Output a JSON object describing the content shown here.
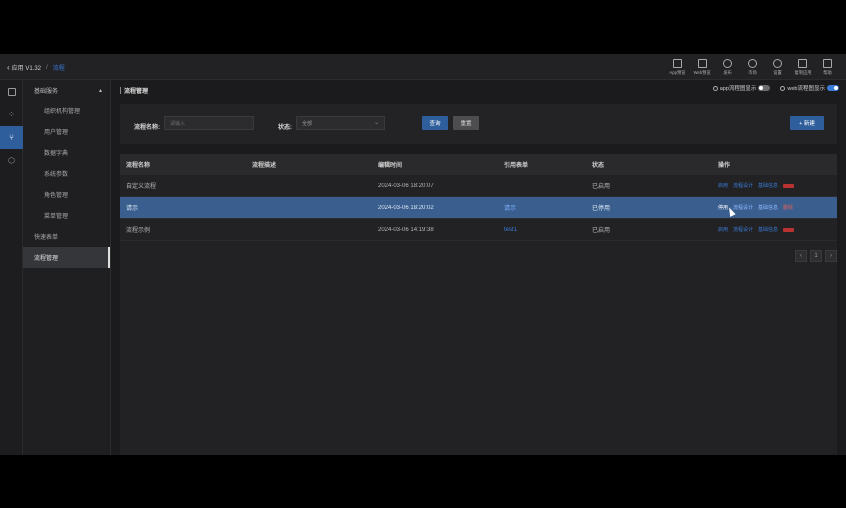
{
  "topbar": {
    "back_label": "应用 V1.32",
    "separator": "/",
    "current": "流程",
    "tools": [
      {
        "icon": "app-icon",
        "label": "App预览"
      },
      {
        "icon": "web-icon",
        "label": "Web预览"
      },
      {
        "icon": "publish-icon",
        "label": "发布"
      },
      {
        "icon": "market-icon",
        "label": "市场"
      },
      {
        "icon": "settings-icon",
        "label": "设置"
      },
      {
        "icon": "shortcut-icon",
        "label": "复制应用"
      },
      {
        "icon": "help-icon",
        "label": "帮助"
      }
    ]
  },
  "rail": {
    "items": [
      {
        "icon": "layout-icon",
        "active": false
      },
      {
        "icon": "components-icon",
        "active": false
      },
      {
        "icon": "flow-icon",
        "active": true
      },
      {
        "icon": "cube-icon",
        "active": false
      }
    ]
  },
  "sidebar": {
    "group": "基础服务",
    "items": [
      {
        "label": "组织机构管理",
        "level": 2
      },
      {
        "label": "用户管理",
        "level": 2
      },
      {
        "label": "数据字典",
        "level": 2
      },
      {
        "label": "系统参数",
        "level": 2
      },
      {
        "label": "角色管理",
        "level": 2
      },
      {
        "label": "菜单管理",
        "level": 2
      },
      {
        "label": "快速表单",
        "level": 1
      },
      {
        "label": "流程管理",
        "level": 1,
        "active": true
      }
    ]
  },
  "header": {
    "title": "流程管理",
    "app_toggle_label": "app流程图显示",
    "web_toggle_label": "web流程图显示"
  },
  "filter": {
    "name_label": "流程名称:",
    "name_placeholder": "请输入",
    "status_label": "状态:",
    "status_value": "全部",
    "query_label": "查询",
    "reset_label": "重置",
    "new_label": "+ 新建"
  },
  "table": {
    "columns": [
      "流程名称",
      "流程描述",
      "编辑时间",
      "引用表单",
      "状态",
      "操作"
    ],
    "rows": [
      {
        "name": "自定义流程",
        "desc": "",
        "time": "2024-03-06 18:20:07",
        "form": "",
        "status": "已启用",
        "selected": false
      },
      {
        "name": "请示",
        "desc": "",
        "time": "2024-03-06 18:20:02",
        "form": "请示",
        "status": "已停用",
        "selected": true
      },
      {
        "name": "流程示例",
        "desc": "",
        "time": "2024-03-06 14:19:38",
        "form": "test1",
        "status": "已启用",
        "selected": false
      }
    ],
    "row_actions": [
      "启用",
      "流程设计",
      "基础信息",
      "删除"
    ],
    "selected_row_first_action": "停用"
  },
  "pager": {
    "prev": "‹",
    "page": "1",
    "next": "›"
  },
  "colors": {
    "accent": "#2f5e9c",
    "link": "#3a7bd5",
    "danger": "#b83232",
    "selected_row": "#3a5f8f"
  }
}
